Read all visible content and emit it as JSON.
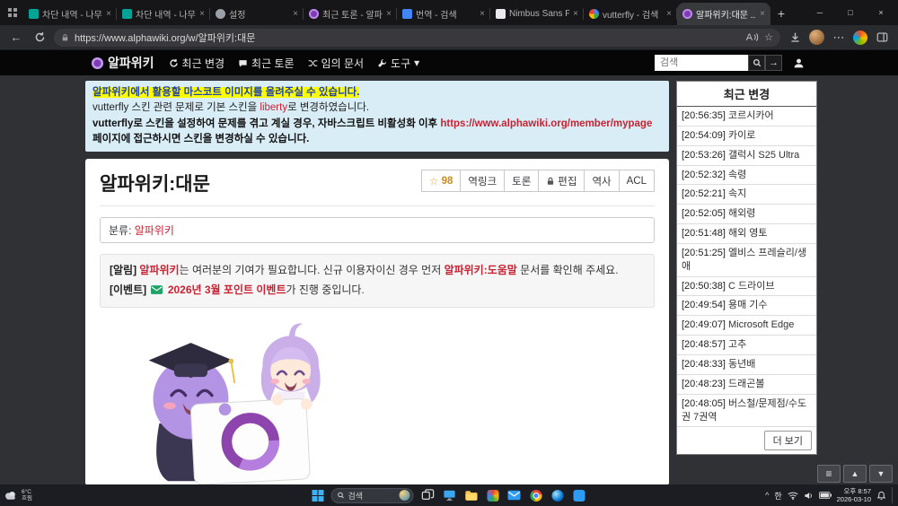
{
  "icons": {
    "close": "×",
    "minimize": "─",
    "maximize": "□",
    "new_tab": "+",
    "back": "←",
    "more": "⋯",
    "star_outline": "☆",
    "star_filled": "★",
    "caret_down": "▾",
    "arrow_right": "→",
    "list": "≡",
    "arrow_up": "▲",
    "arrow_down": "▼",
    "chevron_up": "^",
    "read_aloud": "A"
  },
  "browser": {
    "tabs": [
      {
        "label": "차단 내역 - 나무..."
      },
      {
        "label": "차단 내역 - 나무..."
      },
      {
        "label": "설정"
      },
      {
        "label": "최근 토론 - 알파위..."
      },
      {
        "label": "번역 - 검색"
      },
      {
        "label": "Nimbus Sans Fon..."
      },
      {
        "label": "vutterfly - 검색"
      },
      {
        "label": "알파위키:대문 ..."
      }
    ],
    "url": "https://www.alphawiki.org/w/알파위키:대문"
  },
  "wiki": {
    "header": {
      "logo": "알파위키",
      "nav": [
        {
          "label": "최근 변경"
        },
        {
          "label": "최근 토론"
        },
        {
          "label": "임의 문서"
        },
        {
          "label": "도구"
        }
      ],
      "search_placeholder": "검색"
    },
    "site_notice": {
      "line1": "알파위키에서 활용할 마스코트 이미지를 올려주실 수 있습니다.",
      "line2_pre": "vutterfly 스킨 관련 문제로 기본 스킨을 ",
      "line2_link": "liberty",
      "line2_post": "로 변경하였습니다.",
      "line3_pre": "vutterfly로 스킨을 설정하여 문제를 겪고 계실 경우, 자바스크립트 비활성화 이후 ",
      "line3_link": "https://www.alphawiki.org/member/mypage",
      "line3_post": " 페이지에 접근하시면 스킨을 변경하실 수 있습니다."
    },
    "article": {
      "title": "알파위키:대문",
      "star_count": "98",
      "btn_backlinks": "역링크",
      "btn_discuss": "토론",
      "btn_edit": "편집",
      "btn_history": "역사",
      "btn_acl": "ACL",
      "category_label": "분류:",
      "category_link": "알파위키",
      "notice1_tag": "[알림]",
      "notice1_link1": "알파위키",
      "notice1_mid1": "는 여러분의 기여가 필요합니다. 신규 이용자이신 경우 먼저 ",
      "notice1_link2": "알파위키:도움말",
      "notice1_post": " 문서를 확인해 주세요.",
      "notice2_tag": "[이벤트]",
      "notice2_link": "2026년 3월 포인트 이벤트",
      "notice2_post": "가 진행 중입니다."
    },
    "recent_changes": {
      "title": "최근 변경",
      "items": [
        {
          "time": "[20:56:35]",
          "title": "코르시카어"
        },
        {
          "time": "[20:54:09]",
          "title": "카이로"
        },
        {
          "time": "[20:53:26]",
          "title": "갤럭시 S25 Ultra"
        },
        {
          "time": "[20:52:32]",
          "title": "속령"
        },
        {
          "time": "[20:52:21]",
          "title": "속지"
        },
        {
          "time": "[20:52:05]",
          "title": "해외령"
        },
        {
          "time": "[20:51:48]",
          "title": "해외 영토"
        },
        {
          "time": "[20:51:25]",
          "title": "엘비스 프레슬리/생애"
        },
        {
          "time": "[20:50:38]",
          "title": "C 드라이브"
        },
        {
          "time": "[20:49:54]",
          "title": "용매 기수"
        },
        {
          "time": "[20:49:07]",
          "title": "Microsoft Edge"
        },
        {
          "time": "[20:48:57]",
          "title": "고추"
        },
        {
          "time": "[20:48:33]",
          "title": "동년배"
        },
        {
          "time": "[20:48:23]",
          "title": "드래곤볼"
        },
        {
          "time": "[20:48:05]",
          "title": "버스철/문제점/수도권 7권역"
        }
      ],
      "more_label": "더 보기"
    }
  },
  "taskbar": {
    "weather_temp": "6°C",
    "weather_desc": "흐림",
    "search_label": "검색",
    "ime": "한",
    "time": "오후 8:57",
    "date": "2026-03-10"
  },
  "colors": {
    "accent_purple": "#7d3cb5",
    "link_red": "#c82333",
    "notice_bg": "#d9edf7",
    "highlight_yellow": "#fdfd00"
  }
}
